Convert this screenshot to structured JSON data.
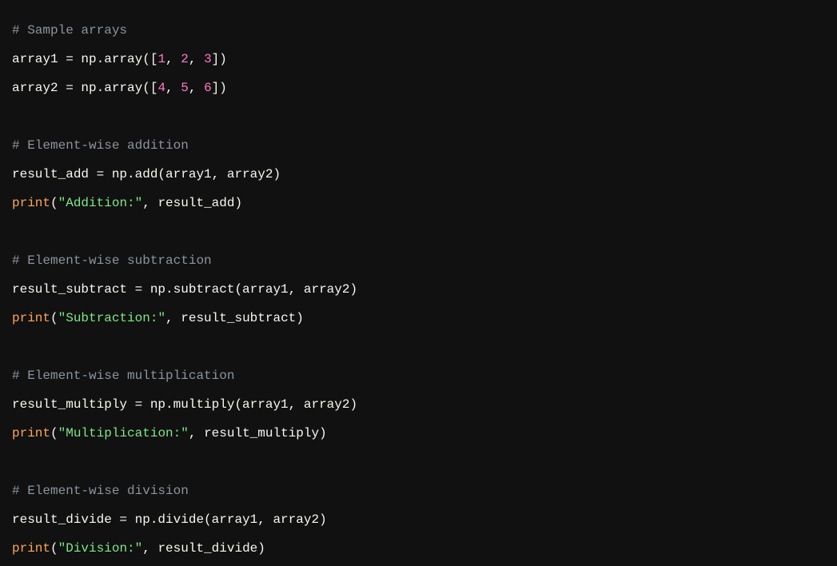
{
  "lines": [
    {
      "type": "code",
      "tokens": [
        {
          "cls": "comment",
          "t": "# Sample arrays"
        }
      ]
    },
    {
      "type": "code",
      "tokens": [
        {
          "cls": "default",
          "t": "array1 = np.array(["
        },
        {
          "cls": "number",
          "t": "1"
        },
        {
          "cls": "default",
          "t": ", "
        },
        {
          "cls": "number",
          "t": "2"
        },
        {
          "cls": "default",
          "t": ", "
        },
        {
          "cls": "number",
          "t": "3"
        },
        {
          "cls": "default",
          "t": "])"
        }
      ]
    },
    {
      "type": "code",
      "tokens": [
        {
          "cls": "default",
          "t": "array2 = np.array(["
        },
        {
          "cls": "number",
          "t": "4"
        },
        {
          "cls": "default",
          "t": ", "
        },
        {
          "cls": "number",
          "t": "5"
        },
        {
          "cls": "default",
          "t": ", "
        },
        {
          "cls": "number",
          "t": "6"
        },
        {
          "cls": "default",
          "t": "])"
        }
      ]
    },
    {
      "type": "blank"
    },
    {
      "type": "code",
      "tokens": [
        {
          "cls": "comment",
          "t": "# Element-wise addition"
        }
      ]
    },
    {
      "type": "code",
      "tokens": [
        {
          "cls": "default",
          "t": "result_add = np.add(array1, array2)"
        }
      ]
    },
    {
      "type": "code",
      "tokens": [
        {
          "cls": "builtin",
          "t": "print"
        },
        {
          "cls": "default",
          "t": "("
        },
        {
          "cls": "string",
          "t": "\"Addition:\""
        },
        {
          "cls": "default",
          "t": ", result_add)"
        }
      ]
    },
    {
      "type": "blank"
    },
    {
      "type": "code",
      "tokens": [
        {
          "cls": "comment",
          "t": "# Element-wise subtraction"
        }
      ]
    },
    {
      "type": "code",
      "tokens": [
        {
          "cls": "default",
          "t": "result_subtract = np.subtract(array1, array2)"
        }
      ]
    },
    {
      "type": "code",
      "tokens": [
        {
          "cls": "builtin",
          "t": "print"
        },
        {
          "cls": "default",
          "t": "("
        },
        {
          "cls": "string",
          "t": "\"Subtraction:\""
        },
        {
          "cls": "default",
          "t": ", result_subtract)"
        }
      ]
    },
    {
      "type": "blank"
    },
    {
      "type": "code",
      "tokens": [
        {
          "cls": "comment",
          "t": "# Element-wise multiplication"
        }
      ]
    },
    {
      "type": "code",
      "tokens": [
        {
          "cls": "default",
          "t": "result_multiply = np.multiply(array1, array2)"
        }
      ]
    },
    {
      "type": "code",
      "tokens": [
        {
          "cls": "builtin",
          "t": "print"
        },
        {
          "cls": "default",
          "t": "("
        },
        {
          "cls": "string",
          "t": "\"Multiplication:\""
        },
        {
          "cls": "default",
          "t": ", result_multiply)"
        }
      ]
    },
    {
      "type": "blank"
    },
    {
      "type": "code",
      "tokens": [
        {
          "cls": "comment",
          "t": "# Element-wise division"
        }
      ]
    },
    {
      "type": "code",
      "tokens": [
        {
          "cls": "default",
          "t": "result_divide = np.divide(array1, array2)"
        }
      ]
    },
    {
      "type": "code",
      "tokens": [
        {
          "cls": "builtin",
          "t": "print"
        },
        {
          "cls": "default",
          "t": "("
        },
        {
          "cls": "string",
          "t": "\"Division:\""
        },
        {
          "cls": "default",
          "t": ", result_divide)"
        }
      ]
    }
  ]
}
